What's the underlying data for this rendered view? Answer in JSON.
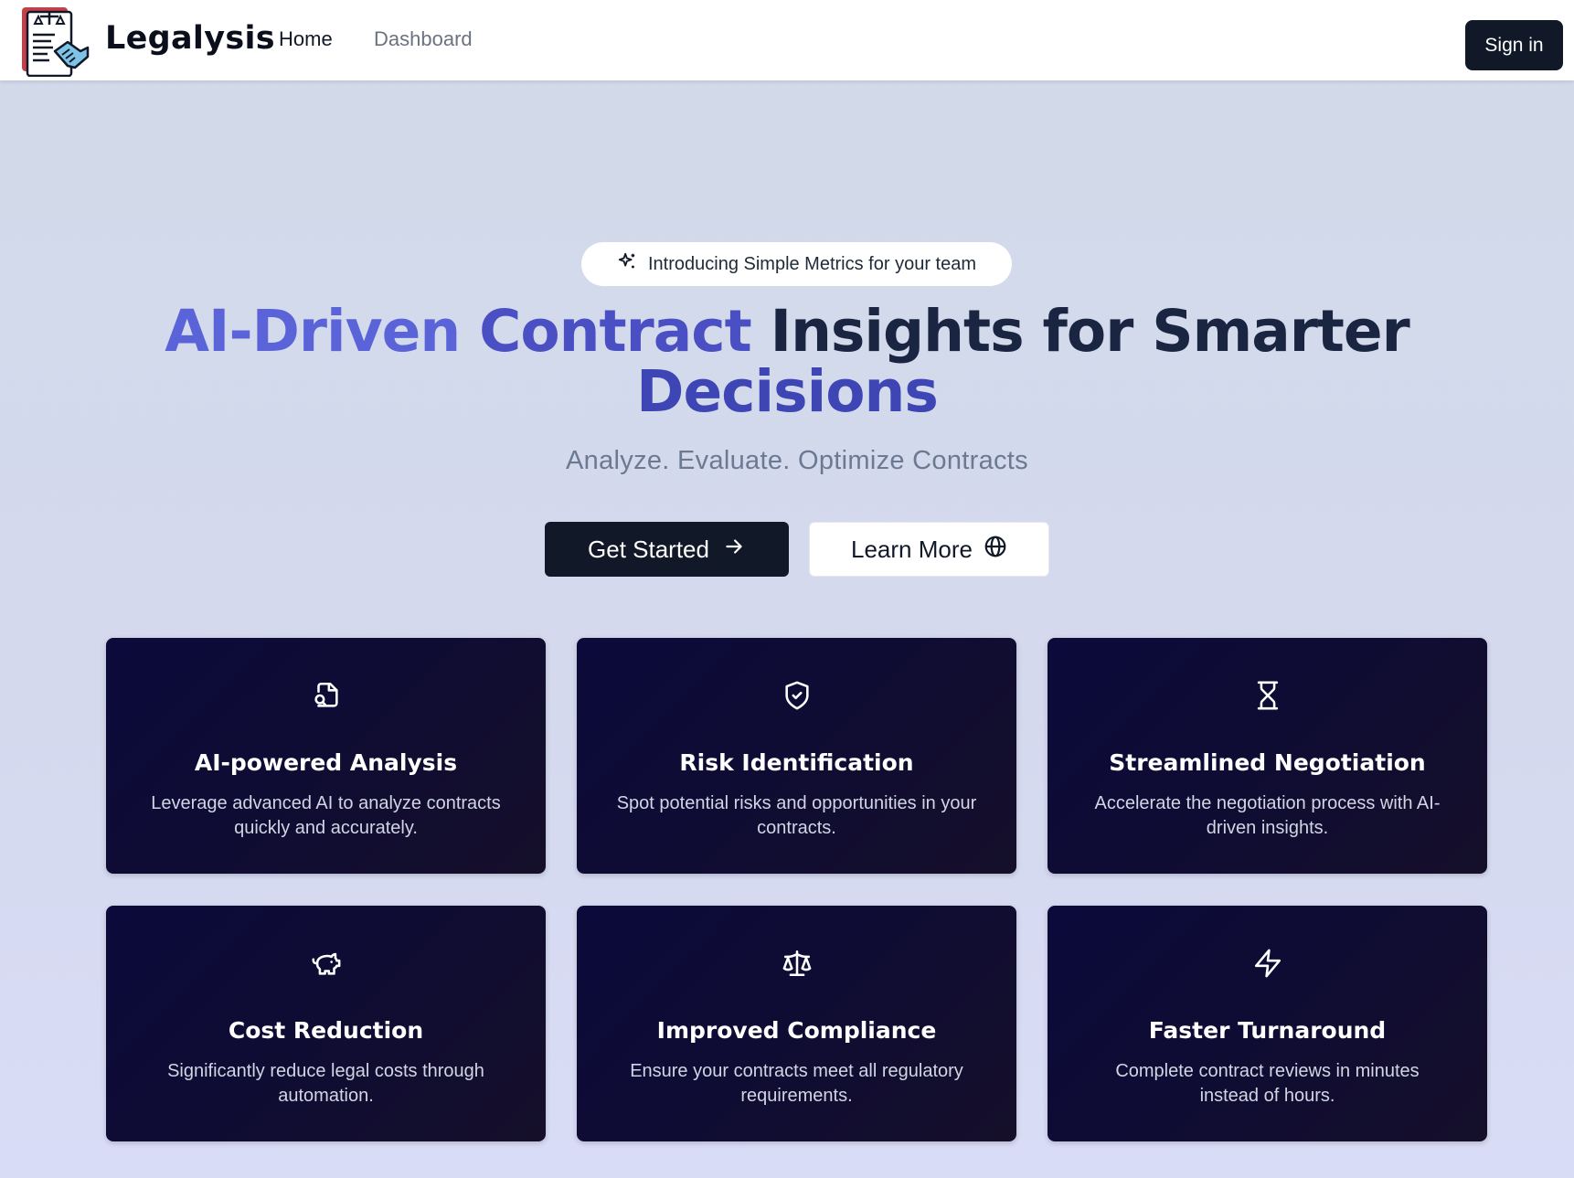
{
  "nav": {
    "brand": "Legalysis",
    "links": [
      "Home",
      "Dashboard"
    ],
    "signin_label": "Sign in"
  },
  "hero": {
    "pill_text": "Introducing Simple Metrics for your team",
    "headline": {
      "part1": "AI-Driven",
      "part2": "Contract",
      "part3": "Insights for Smarter",
      "part4": "Decisions"
    },
    "subheadline": "Analyze. Evaluate. Optimize Contracts",
    "primary_cta": "Get Started",
    "secondary_cta": "Learn More"
  },
  "features": [
    {
      "icon": "file-search-icon",
      "title": "AI-powered Analysis",
      "desc": "Leverage advanced AI to analyze contracts quickly and accurately."
    },
    {
      "icon": "shield-check-icon",
      "title": "Risk Identification",
      "desc": "Spot potential risks and opportunities in your contracts."
    },
    {
      "icon": "hourglass-icon",
      "title": "Streamlined Negotiation",
      "desc": "Accelerate the negotiation process with AI-driven insights."
    },
    {
      "icon": "piggy-bank-icon",
      "title": "Cost Reduction",
      "desc": "Significantly reduce legal costs through automation."
    },
    {
      "icon": "scale-icon",
      "title": "Improved Compliance",
      "desc": "Ensure your contracts meet all regulatory requirements."
    },
    {
      "icon": "zap-icon",
      "title": "Faster Turnaround",
      "desc": "Complete contract reviews in minutes instead of hours."
    }
  ],
  "colors": {
    "primary_dark": "#111827",
    "headline_blue": "#5b63d8",
    "headline_navy": "#1a2541",
    "card_bg": "#0f0c33"
  }
}
